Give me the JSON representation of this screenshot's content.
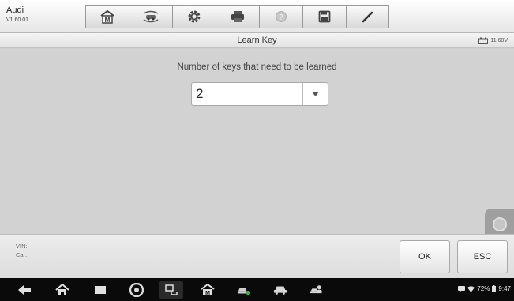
{
  "header": {
    "make": "Audi",
    "version": "V1.60.01",
    "tools": [
      {
        "icon": "home-icon"
      },
      {
        "icon": "vehicle-swap-icon"
      },
      {
        "icon": "settings-icon"
      },
      {
        "icon": "print-icon"
      },
      {
        "icon": "help-icon"
      },
      {
        "icon": "save-icon"
      },
      {
        "icon": "edit-icon"
      }
    ]
  },
  "titlebar": {
    "title": "Learn Key",
    "voltage": "11.68V"
  },
  "main": {
    "prompt": "Number of keys that need to be learned",
    "select_value": "2"
  },
  "footer": {
    "vin_label": "VIN:",
    "car_label": "Car:",
    "ok_label": "OK",
    "esc_label": "ESC"
  },
  "navbar": {
    "icons": [
      "back-icon",
      "home-icon",
      "recents-icon",
      "chrome-icon",
      "remote-icon",
      "maxisys-icon",
      "vehicle-service-icon",
      "car-icon",
      "user-car-icon"
    ],
    "battery": "72%",
    "time": "9:47"
  },
  "colors": {
    "toolbar_bg": "#e6e6e6",
    "main_bg": "#d2d2d2",
    "navbar_bg": "#0a0a0a"
  }
}
